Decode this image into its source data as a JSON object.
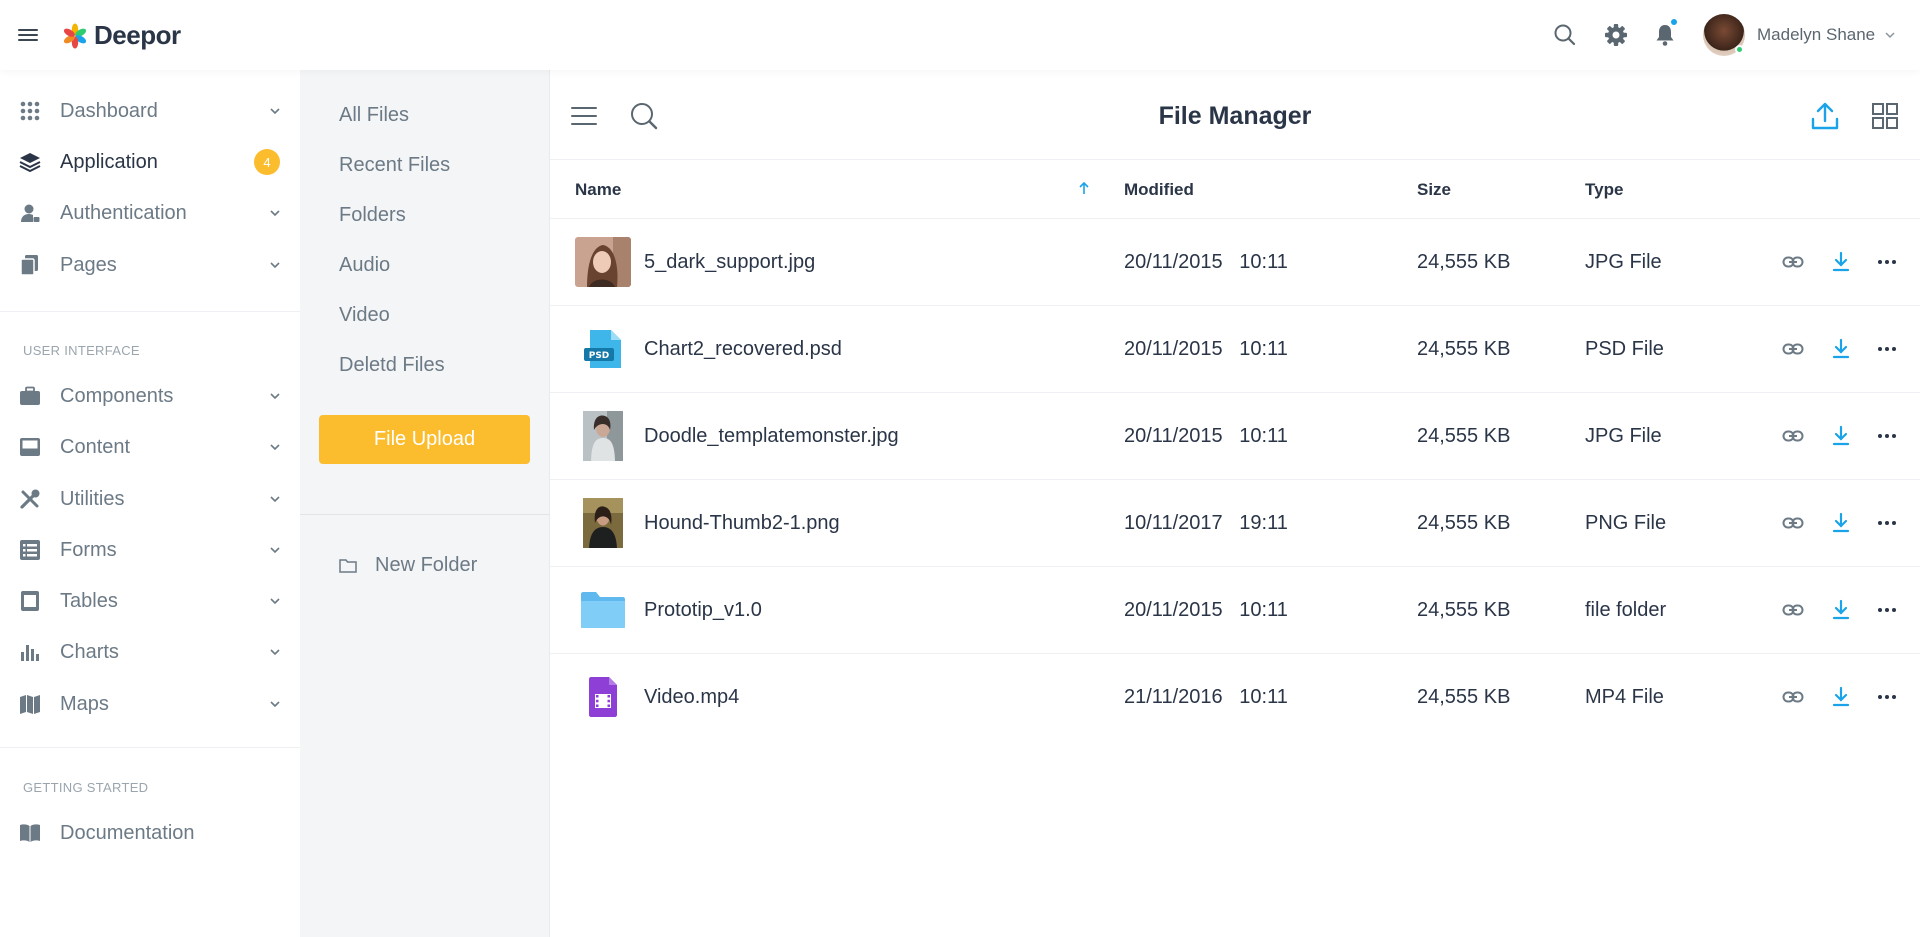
{
  "app": {
    "name": "Deepor"
  },
  "user": {
    "name": "Madelyn Shane"
  },
  "sidebar": {
    "items": [
      {
        "label": "Dashboard",
        "icon": "grid-dots-icon"
      },
      {
        "label": "Application",
        "icon": "layers-icon",
        "badge": "4"
      },
      {
        "label": "Authentication",
        "icon": "user-lock-icon"
      },
      {
        "label": "Pages",
        "icon": "pages-icon"
      },
      {
        "label": "Components",
        "icon": "briefcase-icon"
      },
      {
        "label": "Content",
        "icon": "inbox-icon"
      },
      {
        "label": "Utilities",
        "icon": "tools-icon"
      },
      {
        "label": "Forms",
        "icon": "form-list-icon"
      },
      {
        "label": "Tables",
        "icon": "table-icon"
      },
      {
        "label": "Charts",
        "icon": "bar-chart-icon"
      },
      {
        "label": "Maps",
        "icon": "map-icon"
      },
      {
        "label": "Documentation",
        "icon": "book-icon"
      }
    ],
    "sections": {
      "ui": "USER INTERFACE",
      "started": "GETTING STARTED"
    }
  },
  "files_nav": {
    "links": [
      "All Files",
      "Recent Files",
      "Folders",
      "Audio",
      "Video",
      "Deletd Files"
    ],
    "upload_label": "File Upload",
    "new_folder_label": "New Folder"
  },
  "file_manager": {
    "title": "File Manager",
    "columns": {
      "name": "Name",
      "modified": "Modified",
      "size": "Size",
      "type": "Type"
    },
    "files": [
      {
        "name": "5_dark_support.jpg",
        "modified": "20/11/2015   10:11",
        "size": "24,555 KB",
        "type": "JPG File",
        "thumb": "photo-portrait-woman"
      },
      {
        "name": "Chart2_recovered.psd",
        "modified": "20/11/2015   10:11",
        "size": "24,555 KB",
        "type": "PSD File",
        "thumb": "psd-file-icon",
        "thumb_label": "PSD"
      },
      {
        "name": "Doodle_templatemonster.jpg",
        "modified": "20/11/2015   10:11",
        "size": "24,555 KB",
        "type": "JPG File",
        "thumb": "photo-woman-looking-up"
      },
      {
        "name": "Hound-Thumb2-1.png",
        "modified": "10/11/2017   19:11",
        "size": "24,555 KB",
        "type": "PNG File",
        "thumb": "photo-woman-forest"
      },
      {
        "name": "Prototip_v1.0",
        "modified": "20/11/2015   10:11",
        "size": "24,555 KB",
        "type": "file folder",
        "thumb": "folder-icon"
      },
      {
        "name": "Video.mp4",
        "modified": "21/11/2016   10:11",
        "size": "24,555 KB",
        "type": "MP4 File",
        "thumb": "video-file-icon"
      }
    ]
  },
  "colors": {
    "accent": "#1aa3e8",
    "upload_button": "#fbbc2e",
    "badge": "#fbbc2e",
    "text_primary": "#2a3547",
    "text_muted": "#6c7a86",
    "panel_bg": "#f4f5f7",
    "folder": "#74c7f5",
    "video_file": "#8e3fd6"
  }
}
